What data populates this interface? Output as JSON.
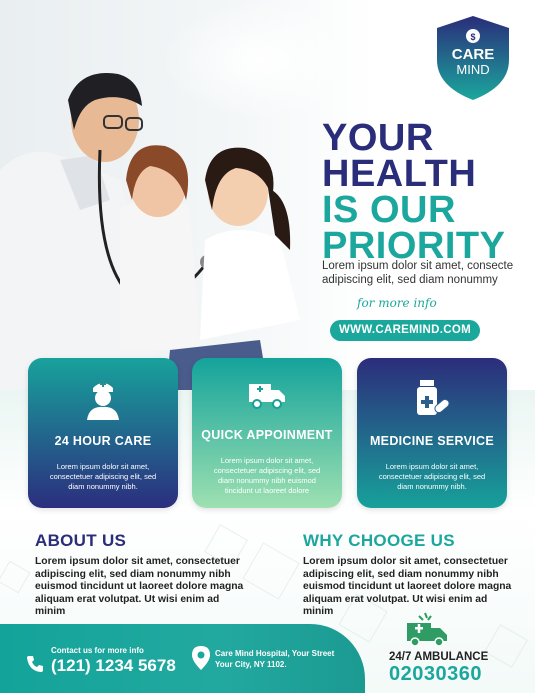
{
  "brand": {
    "line1": "CARE",
    "line2": "MIND"
  },
  "headline": {
    "line1": "YOUR",
    "line2": "HEALTH",
    "line3": "IS OUR",
    "line4": "PRIORITY"
  },
  "hero_text": "Lorem ipsum dolor sit amet, consecte adipiscing elit, sed diam nonummy",
  "more_info": "for more info",
  "website": "WWW.CAREMIND.COM",
  "cards": [
    {
      "title": "24 HOUR CARE",
      "icon": "nurse-icon",
      "body": "Lorem ipsum dolor sit amet, consectetuer adipiscing elit, sed diam nonummy nibh."
    },
    {
      "title": "QUICK APPOINMENT",
      "icon": "ambulance-icon",
      "body": "Lorem ipsum dolor sit amet, consectetuer adipiscing elit, sed diam nonummy nibh euismod tincidunt ut laoreet dolore"
    },
    {
      "title": "MEDICINE SERVICE",
      "icon": "medicine-icon",
      "body": "Lorem ipsum dolor sit amet, consectetuer adipiscing elit, sed diam nonummy nibh."
    }
  ],
  "about": {
    "title": "ABOUT US",
    "body": "Lorem ipsum dolor sit amet, consectetuer adipiscing elit, sed diam nonummy nibh euismod tincidunt ut laoreet dolore magna aliquam erat volutpat. Ut wisi enim ad minim"
  },
  "why": {
    "title": "WHY CHOOGE US",
    "body": "Lorem ipsum dolor sit amet, consectetuer adipiscing elit, sed diam nonummy nibh euismod tincidunt ut laoreet dolore magna aliquam erat volutpat. Ut wisi enim ad minim"
  },
  "contact": {
    "label": "Contact us for more info",
    "phone": "(121) 1234 5678",
    "address": "Care Mind Hospital, Your Street Your City, NY 1102."
  },
  "ambulance": {
    "label": "24/7 AMBULANCE",
    "number": "02030360"
  },
  "colors": {
    "navy": "#2a2d7a",
    "teal": "#1ba79d"
  }
}
